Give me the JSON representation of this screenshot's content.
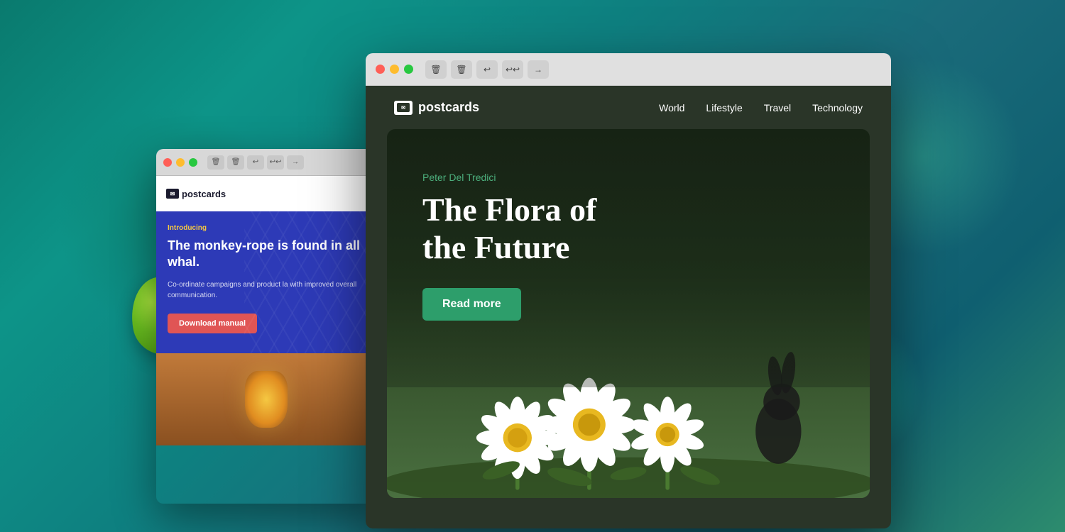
{
  "background": {
    "gradient": "linear-gradient(135deg, #0a7a6e, #2d8c6e)"
  },
  "window_back": {
    "titlebar": {
      "traffic_lights": [
        "red",
        "yellow",
        "green"
      ],
      "buttons": [
        "🗑",
        "🗑",
        "↩",
        "↩↩",
        "→"
      ]
    },
    "logo": "postcards",
    "introducing_label": "Introducing",
    "hero_title": "The monkey-rope is found in all whal.",
    "hero_desc": "Co-ordinate campaigns and product la with improved overall communication.",
    "download_btn_label": "Download manual"
  },
  "window_front": {
    "titlebar": {
      "traffic_lights": [
        "red",
        "yellow",
        "green"
      ],
      "buttons": [
        "🗑",
        "🗑",
        "↩",
        "↩↩",
        "→"
      ]
    },
    "nav": {
      "logo": "postcards",
      "links": [
        "World",
        "Lifestyle",
        "Travel",
        "Technology"
      ]
    },
    "hero": {
      "author": "Peter Del Tredici",
      "title_line1": "The Flora of",
      "title_line2": "the Future",
      "read_more_label": "Read more"
    }
  }
}
